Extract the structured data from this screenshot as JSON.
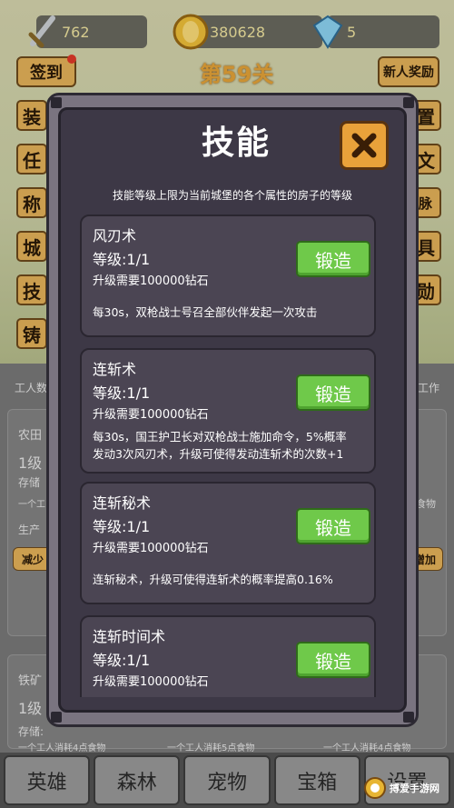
{
  "hud": {
    "attack": "762",
    "gold": "380628",
    "gems": "5"
  },
  "top_buttons": {
    "checkin": "签到",
    "level": "第59关",
    "newbie_reward": "新人奖励"
  },
  "side_left": [
    "装",
    "任",
    "称",
    "城",
    "技",
    "铸"
  ],
  "side_right": [
    "置",
    "文",
    "山脉",
    "具",
    "勋"
  ],
  "background_text": {
    "workers": "工人数",
    "work": "工作",
    "farmland": "农田",
    "level1a": "1级",
    "storage": "存储",
    "worker_note1": "一个工",
    "production": "生产",
    "reduce": "减少",
    "food_right": "食物",
    "increase": "增加",
    "iron_mine": "铁矿",
    "level1b": "1级",
    "storage2": "存储:",
    "consume_note1": "一个工人消耗4点食物",
    "consume_note2": "一个工人消耗5点食物",
    "consume_note3": "一个工人消耗4点食物"
  },
  "modal": {
    "title": "技能",
    "subtitle": "技能等级上限为当前城堡的各个属性的房子的等级",
    "skills": [
      {
        "name": "风刃术",
        "level": "等级:1/1",
        "cost": "升级需要100000钻石",
        "desc_line1": "每30s，双枪战士号召全部伙伴发起一次攻击",
        "desc_line2": "",
        "button": "锻造"
      },
      {
        "name": "连斩术",
        "level": "等级:1/1",
        "cost": "升级需要100000钻石",
        "desc_line1": "每30s，国王护卫长对双枪战士施加命令，5%概率",
        "desc_line2": "发动3次风刃术，升级可使得发动连斩术的次数+1",
        "button": "锻造"
      },
      {
        "name": "连斩秘术",
        "level": "等级:1/1",
        "cost": "升级需要100000钻石",
        "desc_line1": "连斩秘术，升级可使得连斩术的概率提高0.16%",
        "desc_line2": "",
        "button": "锻造"
      },
      {
        "name": "连斩时间术",
        "level": "等级:1/1",
        "cost": "升级需要100000钻石",
        "desc_line1": "",
        "desc_line2": "",
        "button": "锻造"
      }
    ]
  },
  "bottom_nav": [
    "英雄",
    "森林",
    "宠物",
    "宝箱",
    "设置"
  ],
  "watermark": "搏爱手游网",
  "colors": {
    "forge_green": "#6fc94a",
    "close_orange": "#e9a23a",
    "panel_dark": "#3d3846"
  }
}
